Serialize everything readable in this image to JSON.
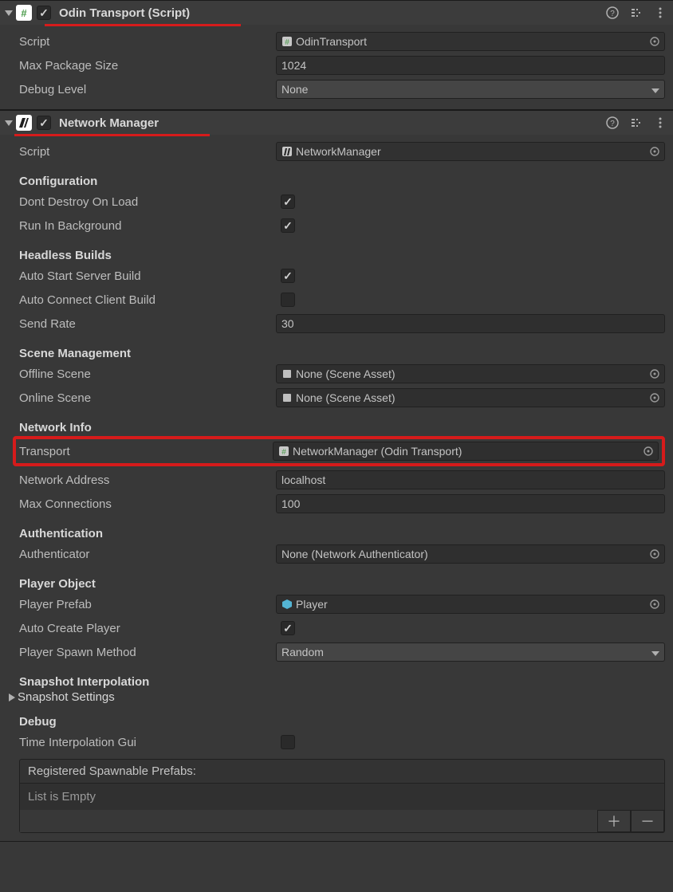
{
  "odin": {
    "title": "Odin Transport (Script)",
    "underline_width": 246,
    "fields": {
      "script_label": "Script",
      "script_value": "OdinTransport",
      "max_pkg_label": "Max Package Size",
      "max_pkg_value": "1024",
      "debug_label": "Debug Level",
      "debug_value": "None"
    }
  },
  "nm": {
    "title": "Network Manager",
    "underline_width": 245,
    "script_label": "Script",
    "script_value": "NetworkManager",
    "sections": {
      "configuration": "Configuration",
      "headless": "Headless Builds",
      "scene": "Scene Management",
      "net": "Network Info",
      "auth": "Authentication",
      "player": "Player Object",
      "snap": "Snapshot Interpolation",
      "debug": "Debug"
    },
    "config": {
      "ddol_label": "Dont Destroy On Load",
      "rib_label": "Run In Background"
    },
    "headless": {
      "auto_server_label": "Auto Start Server Build",
      "auto_client_label": "Auto Connect Client Build",
      "send_rate_label": "Send Rate",
      "send_rate_value": "30"
    },
    "scene": {
      "offline_label": "Offline Scene",
      "offline_value": "None (Scene Asset)",
      "online_label": "Online Scene",
      "online_value": "None (Scene Asset)"
    },
    "net": {
      "transport_label": "Transport",
      "transport_value": "NetworkManager (Odin Transport)",
      "addr_label": "Network Address",
      "addr_value": "localhost",
      "max_conn_label": "Max Connections",
      "max_conn_value": "100"
    },
    "auth": {
      "label": "Authenticator",
      "value": "None (Network Authenticator)"
    },
    "player": {
      "prefab_label": "Player Prefab",
      "prefab_value": "Player",
      "auto_create_label": "Auto Create Player",
      "spawn_label": "Player Spawn Method",
      "spawn_value": "Random"
    },
    "snap": {
      "settings_label": "Snapshot Settings"
    },
    "debug": {
      "tig_label": "Time Interpolation Gui",
      "list_title": "Registered Spawnable Prefabs:",
      "list_empty": "List is Empty"
    }
  }
}
